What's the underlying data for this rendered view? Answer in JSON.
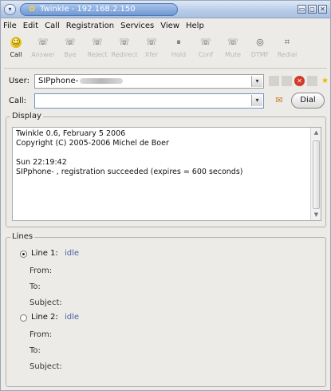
{
  "window": {
    "title": "Twinkle - 192.168.2.150",
    "system_menu_glyph": "▾",
    "controls": [
      "▭",
      "◻",
      "✕"
    ]
  },
  "menu": [
    "File",
    "Edit",
    "Call",
    "Registration",
    "Services",
    "View",
    "Help"
  ],
  "toolbar": [
    {
      "label": "Call",
      "icon": "phone-call-icon",
      "glyph": "☺",
      "enabled": true
    },
    {
      "label": "Answer",
      "icon": "answer-icon",
      "glyph": "☏",
      "enabled": false
    },
    {
      "label": "Bye",
      "icon": "bye-icon",
      "glyph": "☏",
      "enabled": false
    },
    {
      "label": "Reject",
      "icon": "reject-icon",
      "glyph": "☏",
      "enabled": false
    },
    {
      "label": "Redirect",
      "icon": "redirect-icon",
      "glyph": "☏",
      "enabled": false
    },
    {
      "label": "Xfer",
      "icon": "transfer-icon",
      "glyph": "☏",
      "enabled": false
    },
    {
      "label": "Hold",
      "icon": "hold-icon",
      "glyph": "⏸",
      "enabled": false
    },
    {
      "label": "Conf",
      "icon": "conference-icon",
      "glyph": "☏",
      "enabled": false
    },
    {
      "label": "Mute",
      "icon": "mute-icon",
      "glyph": "☏",
      "enabled": false
    },
    {
      "label": "DTMF",
      "icon": "dtmf-icon",
      "glyph": "◎",
      "enabled": false
    },
    {
      "label": "Redial",
      "icon": "redial-icon",
      "glyph": "⌗",
      "enabled": false
    }
  ],
  "user": {
    "label": "User:",
    "value": "SIPphone-",
    "arrow": "▾"
  },
  "status_icons": {
    "red_glyph": "✕",
    "star_glyph": "★"
  },
  "call": {
    "label": "Call:",
    "value": "",
    "arrow": "▾",
    "address_book_glyph": "✉",
    "dial_label": "Dial"
  },
  "display": {
    "title": "Display",
    "lines": [
      "Twinkle 0.6, February 5 2006",
      "Copyright (C) 2005-2006  Michel de Boer",
      "",
      "Sun 22:19:42",
      "SIPphone-                  , registration succeeded (expires = 600 seconds)"
    ],
    "scroll_up": "▲",
    "scroll_down": "▼"
  },
  "lines_group": {
    "title": "Lines",
    "lines": [
      {
        "name": "Line 1:",
        "state": "idle",
        "selected": true,
        "from_label": "From:",
        "to_label": "To:",
        "subject_label": "Subject:"
      },
      {
        "name": "Line 2:",
        "state": "idle",
        "selected": false,
        "from_label": "From:",
        "to_label": "To:",
        "subject_label": "Subject:"
      }
    ]
  }
}
